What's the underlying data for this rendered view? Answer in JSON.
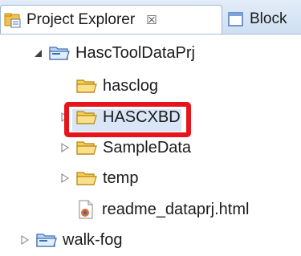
{
  "tabs": [
    {
      "label": "Project Explorer",
      "close_glyph": "☒",
      "active": true,
      "icon": "project-explorer-icon"
    },
    {
      "label": "Block",
      "active": false,
      "icon": "window-icon"
    }
  ],
  "tree": {
    "root": {
      "label": "HascToolDataPrj",
      "expanded": true
    },
    "children": [
      {
        "label": "hasclog",
        "type": "folder",
        "highlighted": true
      },
      {
        "label": "HASCXBD",
        "type": "folder"
      },
      {
        "label": "SampleData",
        "type": "folder"
      },
      {
        "label": "temp",
        "type": "folder"
      },
      {
        "label": "readme_dataprj.html",
        "type": "file"
      }
    ],
    "other_projects": [
      {
        "label": "walk-fog",
        "expanded": false
      }
    ]
  },
  "colors": {
    "highlight": "#e8141b",
    "folder": "#f0b429",
    "tab_bg": "#d6e4f5"
  }
}
